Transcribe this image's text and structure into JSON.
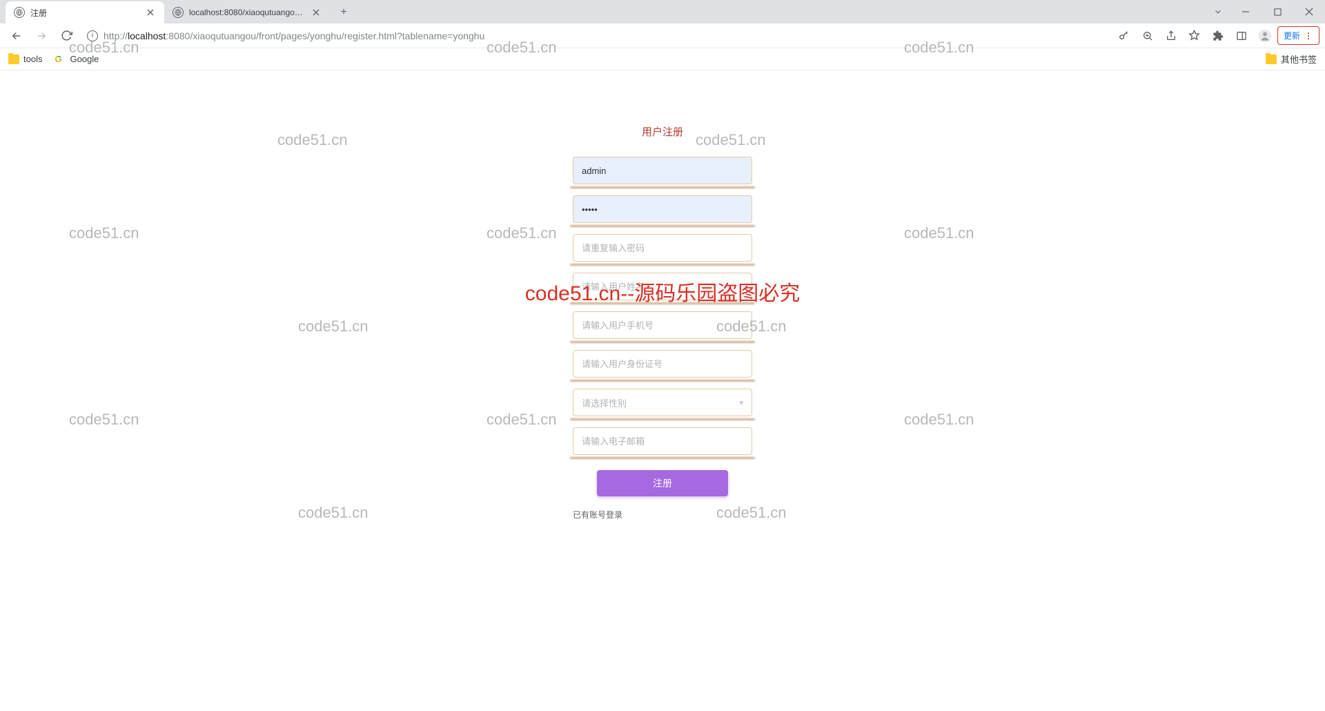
{
  "browser": {
    "tabs": [
      {
        "title": "注册",
        "active": true
      },
      {
        "title": "localhost:8080/xiaoqutuangou...",
        "active": false
      }
    ],
    "url_host": "localhost",
    "url_prefix": "http://",
    "url_port_path": ":8080/xiaoqutuangou/front/pages/yonghu/register.html?tablename=yonghu",
    "update_label": "更新",
    "bookmarks": {
      "tools": "tools",
      "google": "Google",
      "other": "其他书签"
    }
  },
  "form": {
    "title": "用户注册",
    "username_value": "admin",
    "password_value": "•••••",
    "confirm_placeholder": "请重复输入密码",
    "name_placeholder": "请输入用户姓名",
    "phone_placeholder": "请输入用户手机号",
    "idcard_placeholder": "请输入用户身份证号",
    "gender_placeholder": "请选择性别",
    "email_placeholder": "请输入电子邮箱",
    "submit_label": "注册",
    "login_link": "已有账号登录"
  },
  "watermark": {
    "text": "code51.cn",
    "center": "code51.cn--源码乐园盗图必究"
  }
}
